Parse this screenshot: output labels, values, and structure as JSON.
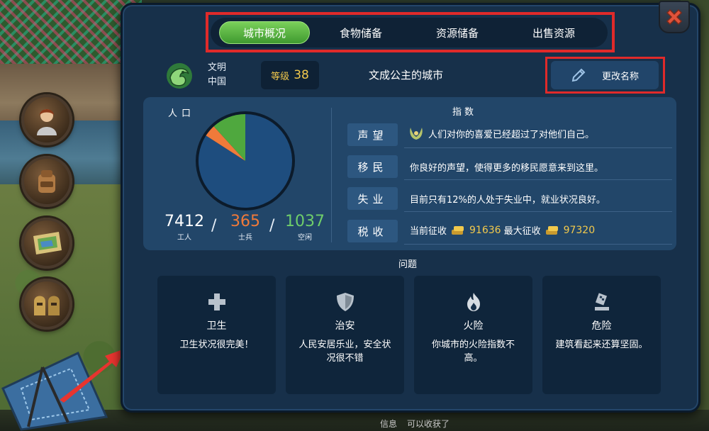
{
  "tabs": [
    {
      "label": "城市概况",
      "active": true
    },
    {
      "label": "食物储备",
      "active": false
    },
    {
      "label": "资源储备",
      "active": false
    },
    {
      "label": "出售资源",
      "active": false
    }
  ],
  "city": {
    "civ_label": "文明",
    "civ_value": "中国",
    "level_label": "等级",
    "level_value": "38",
    "name": "文成公主的城市",
    "rename_label": "更改名称"
  },
  "population": {
    "title": "人口",
    "workers": {
      "value": "7412",
      "label": "工人",
      "color": "#ffffff"
    },
    "soldiers": {
      "value": "365",
      "label": "士兵",
      "color": "#f07a3a"
    },
    "idle": {
      "value": "1037",
      "label": "空闲",
      "color": "#6fce6a"
    },
    "separator": "/"
  },
  "chart_data": {
    "type": "pie",
    "categories": [
      "工人",
      "士兵",
      "空闲"
    ],
    "values": [
      7412,
      365,
      1037
    ],
    "colors": [
      "#1e4d7e",
      "#f07a3a",
      "#4fa83e"
    ]
  },
  "index": {
    "title": "指数",
    "rows": [
      {
        "tag": "声望",
        "text": "人们对你的喜爱已经超过了对他们自己。",
        "icon": "laurel-icon"
      },
      {
        "tag": "移民",
        "text": "你良好的声望，使得更多的移民愿意来到这里。"
      },
      {
        "tag": "失业",
        "text": "目前只有12%的人处于失业中，就业状况良好。"
      },
      {
        "tag": "税收",
        "current_label": "当前征收",
        "current_value": "91636",
        "max_label": "最大征收",
        "max_value": "97320"
      }
    ]
  },
  "issues": {
    "title": "问题",
    "items": [
      {
        "title": "卫生",
        "text": "卫生状况很完美！",
        "icon": "plus-icon"
      },
      {
        "title": "治安",
        "text": "人民安居乐业，安全状况很不错",
        "icon": "shield-icon"
      },
      {
        "title": "火险",
        "text": "你城市的火险指数不高。",
        "icon": "fire-icon"
      },
      {
        "title": "危险",
        "text": "建筑看起来还算坚固。",
        "icon": "building-danger-icon"
      }
    ]
  },
  "bottom_status": {
    "left": "信息",
    "right": "可以收获了"
  },
  "colors": {
    "accent_green": "#4fa83e",
    "highlight_red": "#e02a2a",
    "gold": "#f2c94c"
  }
}
